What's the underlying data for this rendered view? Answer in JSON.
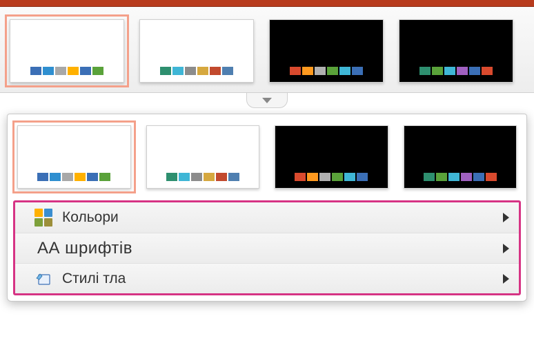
{
  "ribbon_variants": [
    {
      "bg": "light",
      "selected": true,
      "colors": [
        "#3b6fb6",
        "#2f8fd0",
        "#a8a8a8",
        "#ffb100",
        "#3b6fb6",
        "#5aa23a"
      ]
    },
    {
      "bg": "light",
      "selected": false,
      "colors": [
        "#2e8f6f",
        "#3fb6d6",
        "#8c8c8c",
        "#d6a83f",
        "#c24a2e",
        "#4f7fb0"
      ]
    },
    {
      "bg": "dark",
      "selected": false,
      "colors": [
        "#d94a2e",
        "#ff9a1f",
        "#b0b0b0",
        "#5aa23a",
        "#3fb6d6",
        "#3b6fb6"
      ]
    },
    {
      "bg": "dark",
      "selected": false,
      "colors": [
        "#2e8f6f",
        "#5aa23a",
        "#3fb6d6",
        "#a060c0",
        "#3b6fb6",
        "#d94a2e"
      ]
    }
  ],
  "dropdown_variants": [
    {
      "bg": "light",
      "selected": true,
      "colors": [
        "#3b6fb6",
        "#2f8fd0",
        "#a8a8a8",
        "#ffb100",
        "#3b6fb6",
        "#5aa23a"
      ]
    },
    {
      "bg": "light",
      "selected": false,
      "colors": [
        "#2e8f6f",
        "#3fb6d6",
        "#8c8c8c",
        "#d6a83f",
        "#c24a2e",
        "#4f7fb0"
      ]
    },
    {
      "bg": "dark",
      "selected": false,
      "colors": [
        "#d94a2e",
        "#ff9a1f",
        "#b0b0b0",
        "#5aa23a",
        "#3fb6d6",
        "#3b6fb6"
      ]
    },
    {
      "bg": "dark",
      "selected": false,
      "colors": [
        "#2e8f6f",
        "#5aa23a",
        "#3fb6d6",
        "#a060c0",
        "#3b6fb6",
        "#d94a2e"
      ]
    }
  ],
  "menu": {
    "colors_label": "Кольори",
    "fonts_label": "АА шрифтів",
    "bg_label": "Стилі тла",
    "colors_icon_swatches": [
      "#ffb100",
      "#3b8fd0",
      "#7da03a",
      "#9c8f3a"
    ]
  }
}
